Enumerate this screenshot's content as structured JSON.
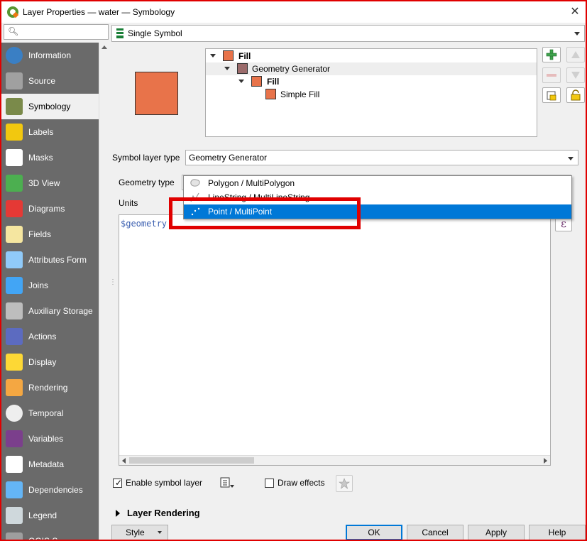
{
  "window": {
    "title": "Layer Properties — water — Symbology"
  },
  "sidebar": {
    "search_placeholder": "",
    "items": [
      {
        "label": "Information",
        "icon": "info-icon",
        "color": "#3a7fc4"
      },
      {
        "label": "Source",
        "icon": "source-icon",
        "color": "#a0a0a0"
      },
      {
        "label": "Symbology",
        "icon": "paintbrush-icon",
        "color": "#7a8a4a",
        "active": true
      },
      {
        "label": "Labels",
        "icon": "labels-abc-icon",
        "color": "#f2c80f"
      },
      {
        "label": "Masks",
        "icon": "masks-abc-icon",
        "color": "#ffffff"
      },
      {
        "label": "3D View",
        "icon": "cube-icon",
        "color": "#4caf50"
      },
      {
        "label": "Diagrams",
        "icon": "diagram-icon",
        "color": "#e53935"
      },
      {
        "label": "Fields",
        "icon": "fields-icon",
        "color": "#f5e6a0"
      },
      {
        "label": "Attributes Form",
        "icon": "form-icon",
        "color": "#90caf9"
      },
      {
        "label": "Joins",
        "icon": "joins-icon",
        "color": "#42a5f5"
      },
      {
        "label": "Auxiliary Storage",
        "icon": "database-icon",
        "color": "#bdbdbd"
      },
      {
        "label": "Actions",
        "icon": "gear-icon",
        "color": "#5c6bc0"
      },
      {
        "label": "Display",
        "icon": "speech-bubble-icon",
        "color": "#fdd835"
      },
      {
        "label": "Rendering",
        "icon": "brush-icon",
        "color": "#f4a742"
      },
      {
        "label": "Temporal",
        "icon": "clock-icon",
        "color": "#eeeeee"
      },
      {
        "label": "Variables",
        "icon": "epsilon-icon",
        "color": "#7b3f8c"
      },
      {
        "label": "Metadata",
        "icon": "metadata-icon",
        "color": "#ffffff"
      },
      {
        "label": "Dependencies",
        "icon": "dependencies-icon",
        "color": "#64b5f6"
      },
      {
        "label": "Legend",
        "icon": "legend-icon",
        "color": "#cfd8dc"
      },
      {
        "label": "QGIS S...",
        "icon": "qgis-server-icon",
        "color": "#9e9e9e"
      }
    ]
  },
  "renderer": {
    "value": "Single Symbol"
  },
  "symbol_tree": [
    {
      "label": "Fill",
      "bold": true,
      "color": "#e8734a"
    },
    {
      "label": "Geometry Generator",
      "bold": false,
      "color": "#9b6b6b"
    },
    {
      "label": "Fill",
      "bold": true,
      "color": "#e8734a"
    },
    {
      "label": "Simple Fill",
      "bold": false,
      "color": "#e8734a"
    }
  ],
  "symbol_layer_type": {
    "label": "Symbol layer type",
    "value": "Geometry Generator"
  },
  "geometry_type": {
    "label": "Geometry type",
    "options": [
      "Polygon / MultiPolygon",
      "LineString / MultiLineString",
      "Point / MultiPoint"
    ],
    "highlighted": "Point / MultiPoint"
  },
  "units": {
    "label": "Units"
  },
  "expression": {
    "text": "$geometry"
  },
  "epsilon_button": "ε",
  "enable_symbol_layer": {
    "label": "Enable symbol layer",
    "checked": true
  },
  "draw_effects": {
    "label": "Draw effects",
    "checked": false
  },
  "layer_rendering": {
    "label": "Layer Rendering"
  },
  "buttons": {
    "style": "Style",
    "ok": "OK",
    "cancel": "Cancel",
    "apply": "Apply",
    "help": "Help"
  },
  "colors": {
    "accent": "#0078d7",
    "highlight_box": "#e00000",
    "fill": "#e8734a"
  }
}
